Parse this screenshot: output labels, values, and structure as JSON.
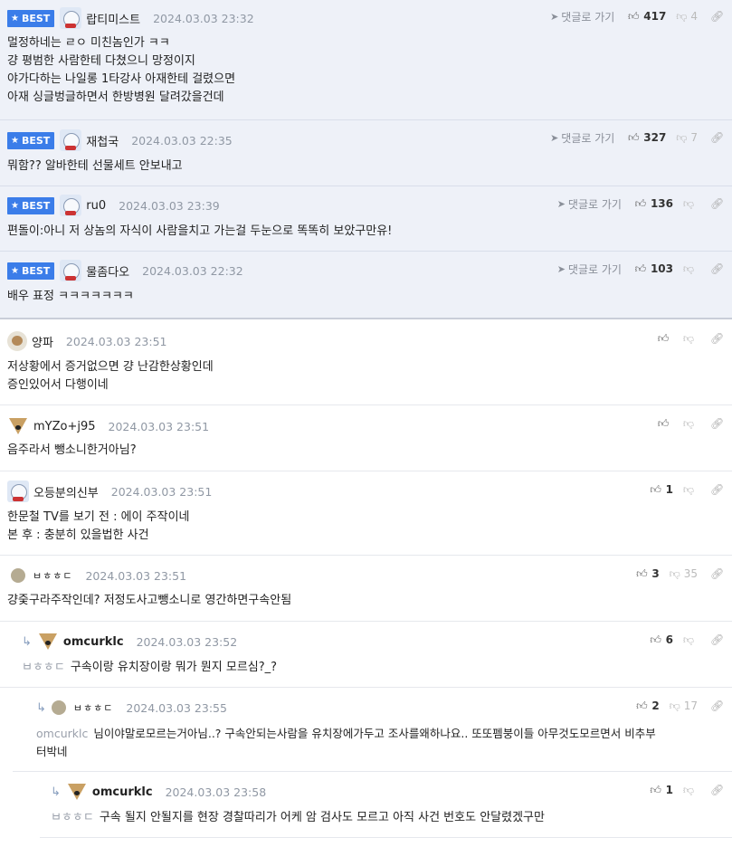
{
  "ui": {
    "best_label": "BEST",
    "goto_label": "댓글로 가기"
  },
  "comments": [
    {
      "nick": "랍티미스트",
      "date": "2024.03.03 23:32",
      "up": "417",
      "down": "4",
      "lines": [
        "멀정하네는 ㄹㅇ 미친놈인가 ㅋㅋ",
        "걍 평범한 사람한테 다쳤으니 망정이지",
        "야가다하는 나일롱 1타강사 아재한테 걸렸으면",
        "아재 싱글벙글하면서 한방병원 달려갔을건데"
      ]
    },
    {
      "nick": "재첩국",
      "date": "2024.03.03 22:35",
      "up": "327",
      "down": "7",
      "lines": [
        "뭐함?? 알바한테 선물세트 안보내고"
      ]
    },
    {
      "nick": "ru0",
      "date": "2024.03.03 23:39",
      "up": "136",
      "down": "",
      "lines": [
        "편돌이:아니 저 상놈의 자식이 사람을치고 가는걸 두눈으로 똑똑히 보았구만유!"
      ]
    },
    {
      "nick": "물좀다오",
      "date": "2024.03.03 22:32",
      "up": "103",
      "down": "",
      "lines": [
        "배우 표정 ㅋㅋㅋㅋㅋㅋㅋ"
      ]
    },
    {
      "nick": "양파",
      "date": "2024.03.03 23:51",
      "up": "",
      "down": "",
      "lines": [
        "저상황에서 증거없으면 걍 난감한상황인데",
        "증인있어서 다행이네"
      ]
    },
    {
      "nick": "mYZo+j95",
      "date": "2024.03.03 23:51",
      "up": "",
      "down": "",
      "lines": [
        "음주라서 뺑소니한거아님?"
      ]
    },
    {
      "nick": "오등분의신부",
      "date": "2024.03.03 23:51",
      "up": "1",
      "down": "",
      "lines": [
        "한문철 TV를 보기 전 : 에이 주작이네",
        "본 후 : 충분히 있을법한 사건"
      ]
    },
    {
      "nick": "ㅂㅎㅎㄷ",
      "date": "2024.03.03 23:51",
      "up": "3",
      "down": "35",
      "lines": [
        "걍줒구라주작인데? 저정도사고뺑소니로 영간하면구속안됨"
      ]
    },
    {
      "nick": "omcurklc",
      "date": "2024.03.03 23:52",
      "up": "6",
      "down": "",
      "mention": "ㅂㅎㅎㄷ",
      "lines": [
        "구속이랑 유치장이랑 뭐가 뭔지 모르심?_?"
      ]
    },
    {
      "nick": "ㅂㅎㅎㄷ",
      "date": "2024.03.03 23:55",
      "up": "2",
      "down": "17",
      "mention": "omcurklc",
      "lines": [
        "님이야말로모르는거아님..? 구속안되는사람을 유치장에가두고 조사를왜하나요.. 또또펨붕이들 아무것도모르면서 비추부",
        "터박네"
      ]
    },
    {
      "nick": "omcurklc",
      "date": "2024.03.03 23:58",
      "up": "1",
      "down": "",
      "mention": "ㅂㅎㅎㄷ",
      "lines": [
        "구속 될지 안될지를 현장 경찰따리가 어케 암 검사도 모르고 아직 사건 번호도 안달렸겠구만"
      ]
    }
  ]
}
